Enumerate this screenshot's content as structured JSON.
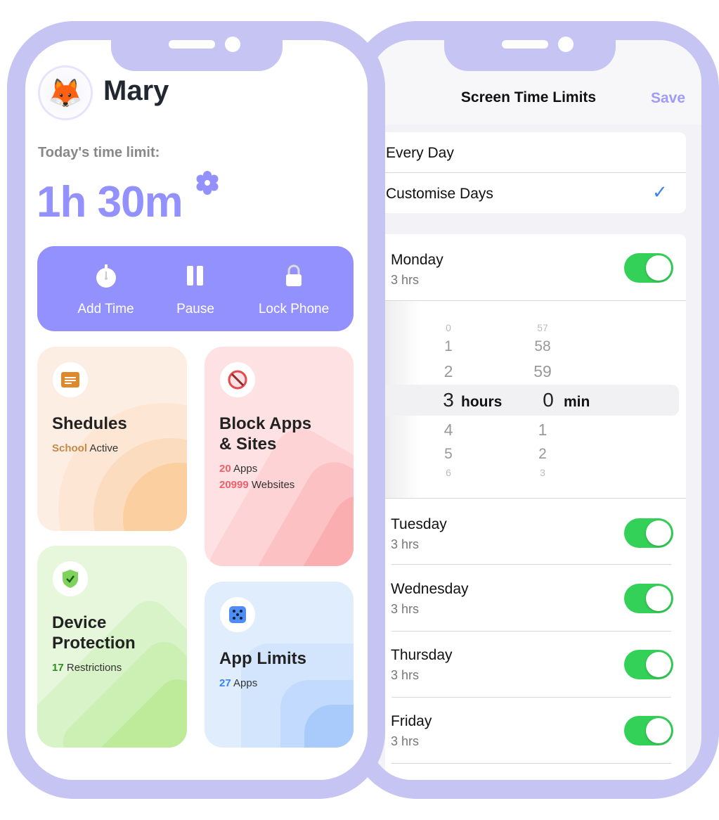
{
  "right_phone": {
    "title": "Screen Time Limits",
    "save_label": "Save",
    "mode_options": [
      {
        "label": "Every Day",
        "selected": false
      },
      {
        "label": "Customise Days",
        "selected": true
      }
    ],
    "days": [
      {
        "name": "Monday",
        "limit": "3 hrs",
        "enabled": true
      },
      {
        "name": "Tuesday",
        "limit": "3 hrs",
        "enabled": true
      },
      {
        "name": "Wednesday",
        "limit": "3 hrs",
        "enabled": true
      },
      {
        "name": "Thursday",
        "limit": "3 hrs",
        "enabled": true
      },
      {
        "name": "Friday",
        "limit": "3 hrs",
        "enabled": true
      }
    ],
    "picker": {
      "hours_above": [
        "0",
        "1",
        "2"
      ],
      "hours_selected": "3",
      "hours_unit": "hours",
      "hours_below": [
        "4",
        "5",
        "6"
      ],
      "minutes_above": [
        "57",
        "58",
        "59"
      ],
      "minutes_selected": "0",
      "minutes_unit": "min",
      "minutes_below": [
        "1",
        "2",
        "3"
      ]
    },
    "colors": {
      "accent": "#a09cf5",
      "toggle_on": "#34d158",
      "check": "#3b82f6"
    }
  },
  "left_phone": {
    "user_name": "Mary",
    "avatar": "🦊",
    "time_limit_label": "Today's time limit:",
    "time_limit_value": "1h 30m",
    "actions": [
      {
        "label": "Add Time",
        "icon": "stopwatch-icon"
      },
      {
        "label": "Pause",
        "icon": "pause-icon"
      },
      {
        "label": "Lock Phone",
        "icon": "lock-icon"
      }
    ],
    "cards": {
      "schedules": {
        "title": "Shedules",
        "highlight": "School",
        "status": "Active"
      },
      "block": {
        "title_1": "Block Apps",
        "title_2": "& Sites",
        "apps_count": "20",
        "apps_label": "Apps",
        "sites_count": "20999",
        "sites_label": "Websites"
      },
      "device": {
        "title_1": "Device",
        "title_2": "Protection",
        "count": "17",
        "label": "Restrictions"
      },
      "app_limits": {
        "title": "App Limits",
        "count": "27",
        "label": "Apps"
      }
    },
    "colors": {
      "accent": "#9391fd",
      "frame": "#c6c4f3"
    }
  }
}
